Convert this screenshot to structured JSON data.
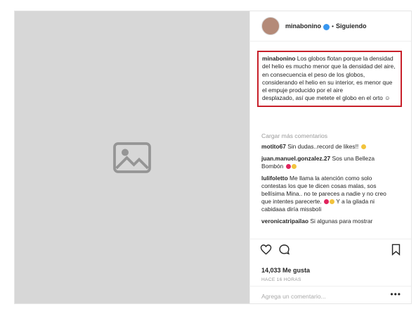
{
  "header": {
    "username": "minabonino",
    "separator": "•",
    "follow_status": "Siguiendo"
  },
  "caption": {
    "username": "minabonino",
    "line1": "Los globos flotan porque la densidad del helio es mucho menor que la densidad del aire, en consecuencia el peso de los globos, considerando el helio en su interior, es menor que el empuje producido por el aire",
    "line2": "desplazado, así que metete el globo en el orto ☺"
  },
  "load_more": "Cargar más comentarios",
  "comments": [
    {
      "user": "motito67",
      "text": "Sin dudas..record de likes!!"
    },
    {
      "user": "juan.manuel.gonzalez.27",
      "text": "Sos una Belleza Bombón"
    },
    {
      "user": "lulifoletto",
      "text": "Me llama la atención como solo contestas los que te dicen cosas malas, sos bellísima Mina.. no te pareces a nadie y no creo que intentes parecerte.",
      "text2": "Y a la gilada ni cabidaaa diría missboli"
    },
    {
      "user": "veronicatripailao",
      "text": "Si algunas para mostrar"
    }
  ],
  "likes": "14,033 Me gusta",
  "time": "HACE 16 HORAS",
  "add_comment_placeholder": "Agrega un comentario...",
  "more_glyph": "•••",
  "icons": [
    "heart-icon",
    "comment-icon",
    "bookmark-icon",
    "verified-icon"
  ],
  "colors": {
    "highlight_box": "#c8202a",
    "verified": "#3897f0",
    "muted": "#999999"
  }
}
